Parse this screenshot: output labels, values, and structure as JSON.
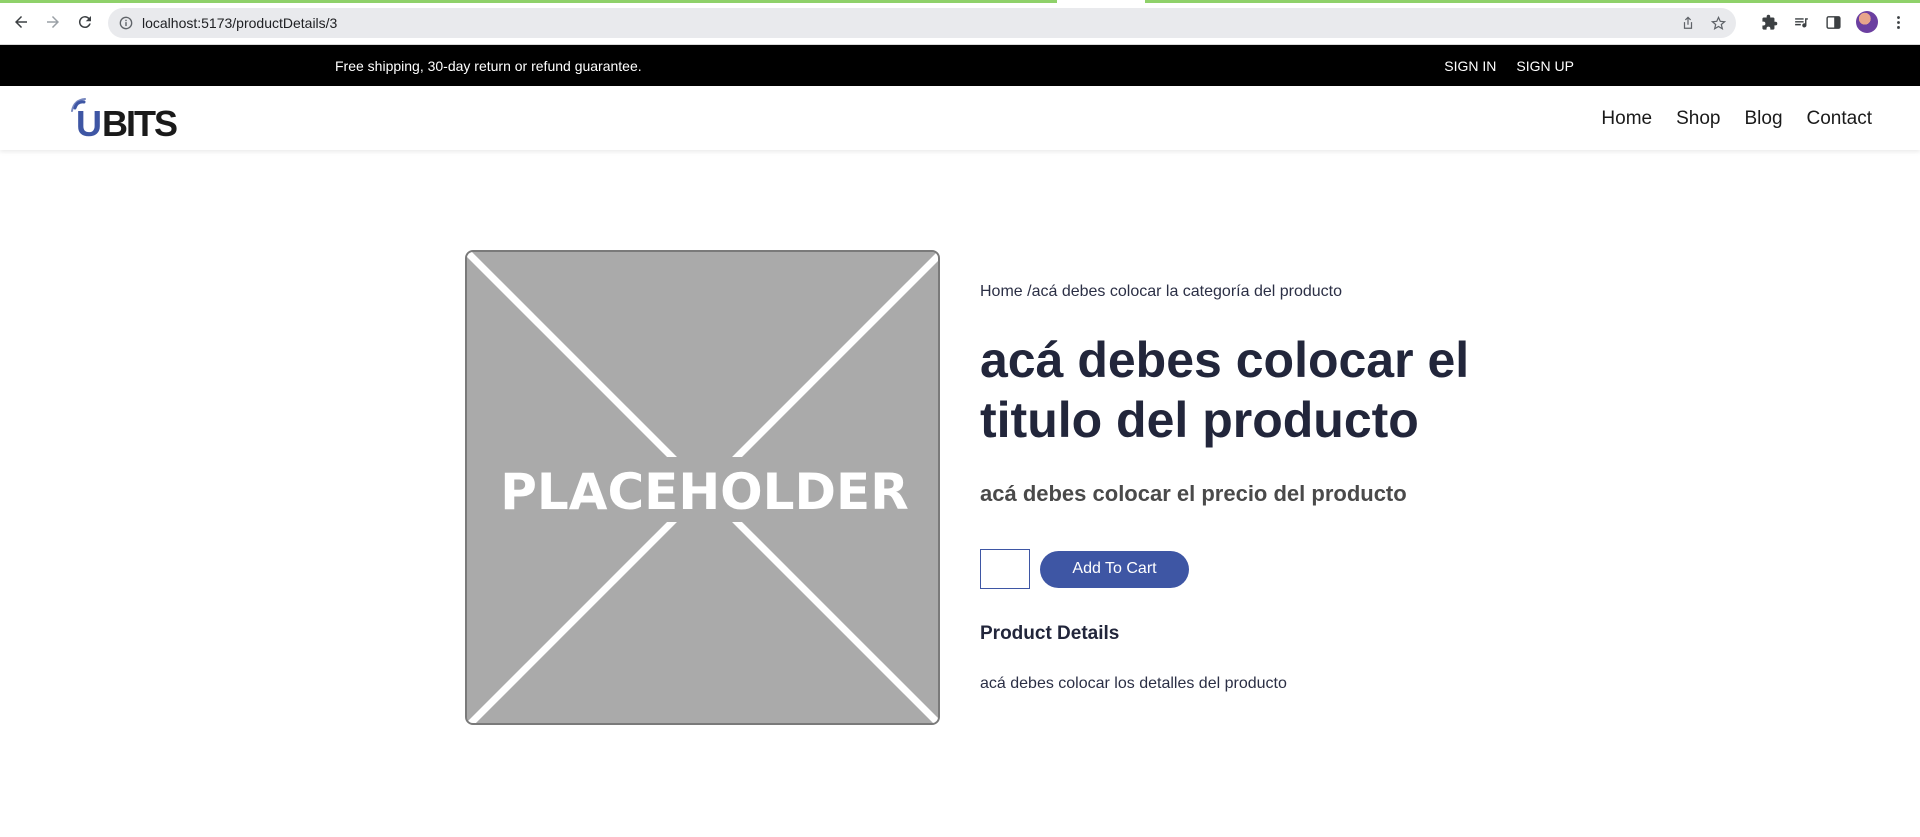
{
  "browser": {
    "url": "localhost:5173/productDetails/3",
    "icons": [
      "back-icon",
      "forward-icon",
      "reload-icon",
      "site-info-icon",
      "share-icon",
      "bookmark-star-icon",
      "extensions-icon",
      "media-icon",
      "side-panel-icon",
      "profile-avatar",
      "menu-icon"
    ]
  },
  "topbar": {
    "message": "Free shipping, 30-day return or refund guarantee.",
    "sign_in": "SIGN IN",
    "sign_up": "SIGN UP"
  },
  "header": {
    "logo_text": "UBITS",
    "nav": [
      "Home",
      "Shop",
      "Blog",
      "Contact"
    ]
  },
  "product": {
    "breadcrumb_home": "Home",
    "breadcrumb_sep": " /",
    "breadcrumb_category": "acá debes colocar la categoría del producto",
    "title": "acá debes colocar el titulo del producto",
    "price": "acá debes colocar el precio del producto",
    "quantity": "",
    "add_to_cart": "Add To Cart",
    "details_heading": "Product Details",
    "details_text": "acá debes colocar los detalles del producto",
    "image_placeholder_text": "PLACEHOLDER"
  },
  "colors": {
    "accent": "#3e56a4",
    "topbar_bg": "#000000",
    "placeholder_bg": "#aaaaaa",
    "title_text": "#22263b"
  }
}
